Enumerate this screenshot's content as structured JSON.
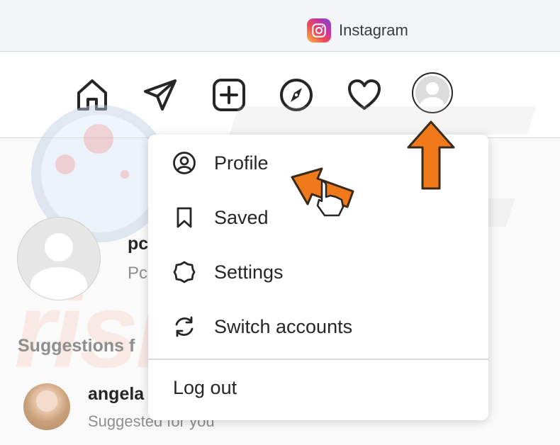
{
  "browser": {
    "tab_title": "Instagram",
    "tab_icon": "instagram-logo-icon"
  },
  "navbar": {
    "icons": [
      "home-icon",
      "direct-message-icon",
      "new-post-icon",
      "explore-icon",
      "activity-heart-icon",
      "profile-avatar-icon"
    ]
  },
  "profile_card": {
    "username": "pc",
    "fullname": "Pc"
  },
  "suggestions": {
    "heading": "Suggestions f",
    "items": [
      {
        "name": "angela",
        "subtitle": "Suggested for you"
      }
    ]
  },
  "menu": {
    "items": [
      {
        "label": "Profile",
        "icon": "profile-circle-icon"
      },
      {
        "label": "Saved",
        "icon": "bookmark-icon"
      },
      {
        "label": "Settings",
        "icon": "gear-icon"
      },
      {
        "label": "Switch accounts",
        "icon": "switch-accounts-icon"
      }
    ],
    "logout_label": "Log out"
  },
  "watermark": {
    "text": "risk.com"
  },
  "colors": {
    "accent_arrow": "#f07a1a",
    "text_primary": "#262626",
    "text_secondary": "#8e8e8e"
  }
}
